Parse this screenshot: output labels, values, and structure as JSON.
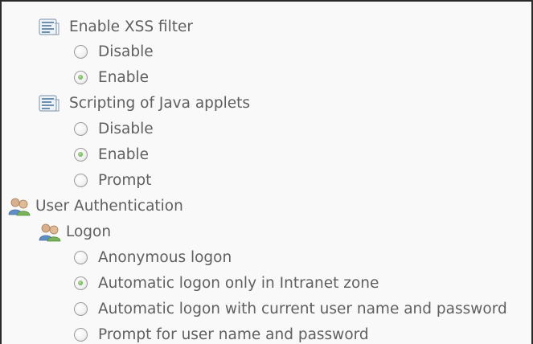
{
  "settings": {
    "xss_filter": {
      "label": "Enable XSS filter",
      "options": [
        "Disable",
        "Enable"
      ],
      "selected": "Enable"
    },
    "java_applets": {
      "label": "Scripting of Java applets",
      "options": [
        "Disable",
        "Enable",
        "Prompt"
      ],
      "selected": "Enable"
    },
    "user_auth": {
      "label": "User Authentication",
      "logon": {
        "label": "Logon",
        "options": [
          "Anonymous logon",
          "Automatic logon only in Intranet zone",
          "Automatic logon with current user name and password",
          "Prompt for user name and password"
        ],
        "selected": "Automatic logon only in Intranet zone"
      }
    }
  },
  "icons": {
    "setting": "script-settings-icon",
    "users": "users-icon"
  },
  "colors": {
    "text": "#5f5f5f",
    "radio_checked": "#6fae4f",
    "border": "#2b2b2b"
  }
}
